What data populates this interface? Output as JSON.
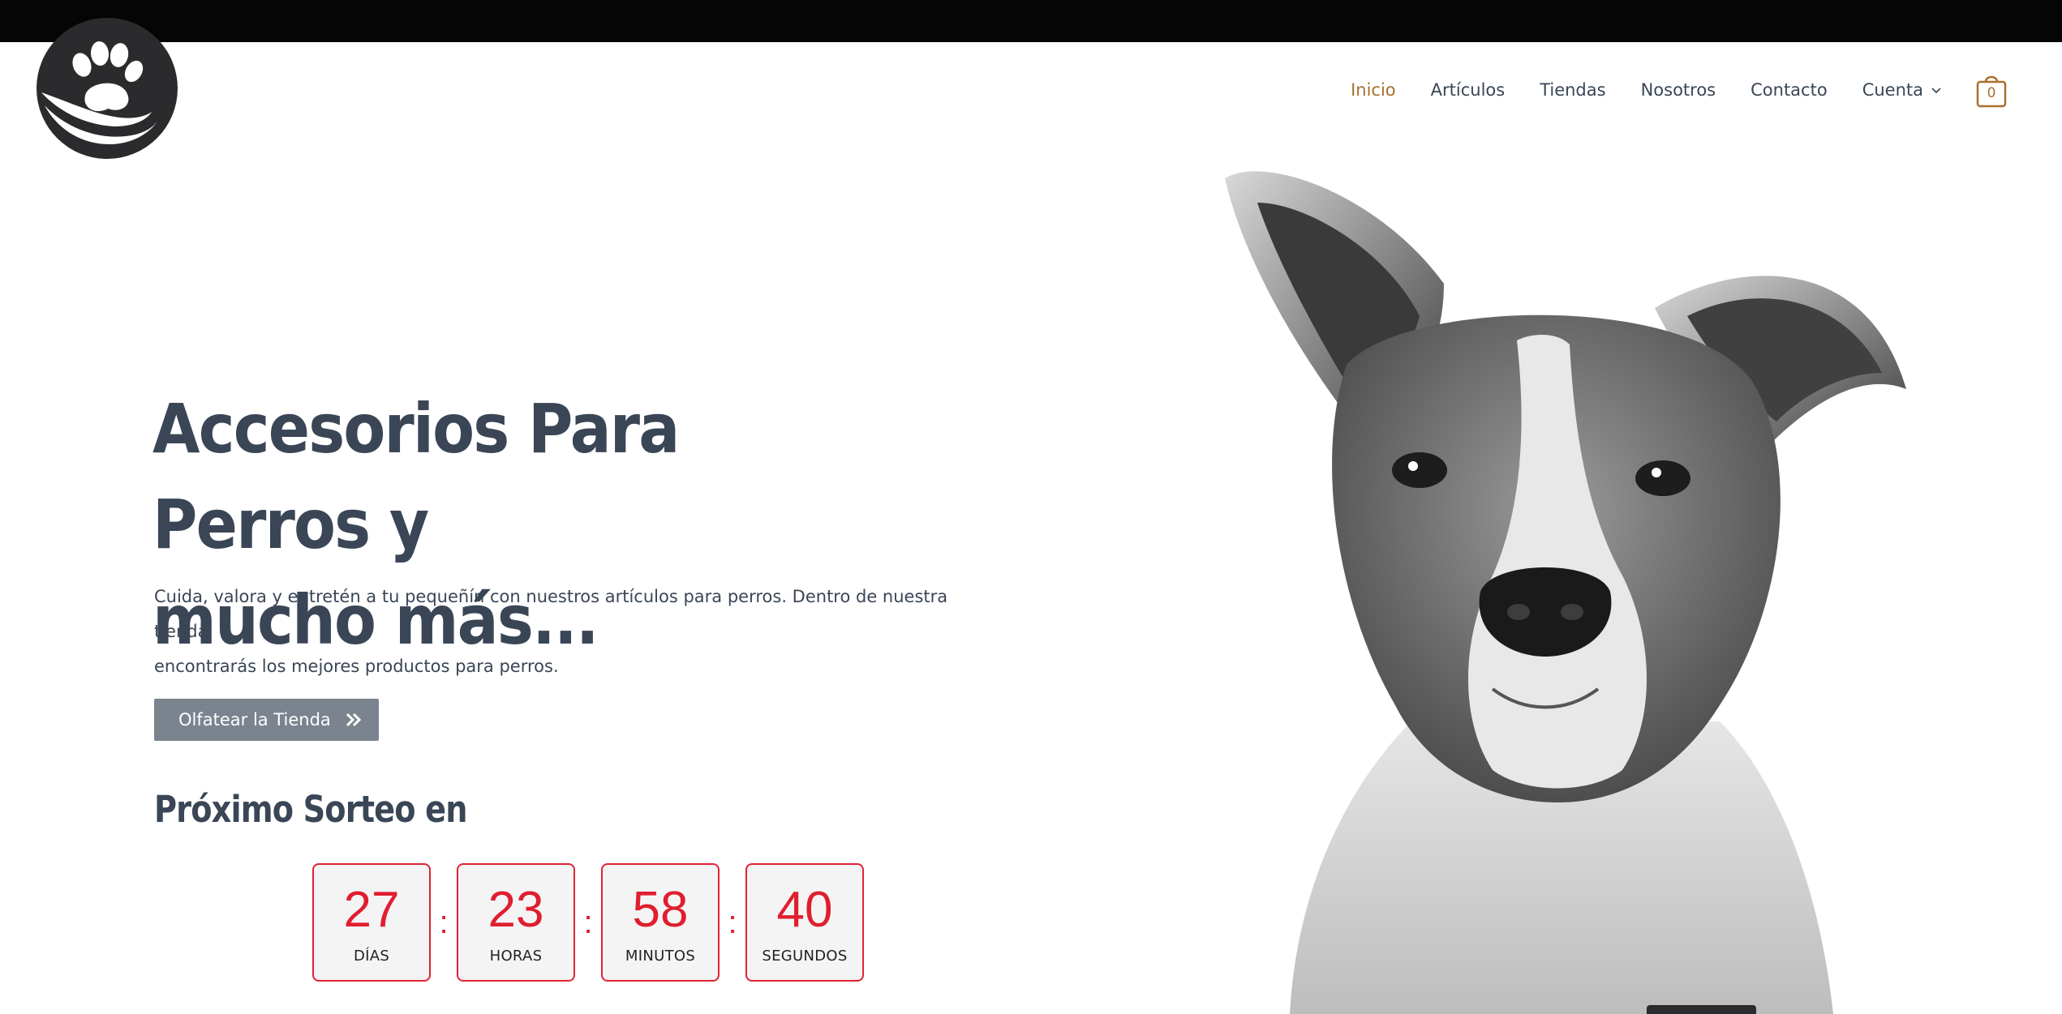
{
  "brand": {
    "logo_icon": "paw-hand-logo-icon"
  },
  "nav": {
    "items": [
      {
        "label": "Inicio",
        "active": true
      },
      {
        "label": "Artículos",
        "active": false
      },
      {
        "label": "Tiendas",
        "active": false
      },
      {
        "label": "Nosotros",
        "active": false
      },
      {
        "label": "Contacto",
        "active": false
      },
      {
        "label": "Cuenta",
        "active": false,
        "dropdown": true
      }
    ],
    "cart_count": "0",
    "accent_color": "#a86f2e"
  },
  "hero": {
    "title_line1": "Accesorios Para Perros y",
    "title_line2": "mucho más...",
    "text_line1": "Cuida, valora y entretén a tu pequeñín con nuestros artículos para perros. Dentro de nuestra tienda",
    "text_line2": "encontrarás los mejores productos para perros.",
    "cta_label": "Olfatear la Tienda",
    "cta_icon": "double-chevron-right-icon"
  },
  "countdown": {
    "heading": "Próximo Sorteo en",
    "days": "27",
    "days_label": "DÍAS",
    "hours": "23",
    "hours_label": "HORAS",
    "minutes": "58",
    "minutes_label": "MINUTOS",
    "seconds": "40",
    "seconds_label": "SEGUNDOS",
    "separator": ":",
    "accent_color": "#e01e2f"
  },
  "image": {
    "subject": "dog-portrait-image"
  }
}
